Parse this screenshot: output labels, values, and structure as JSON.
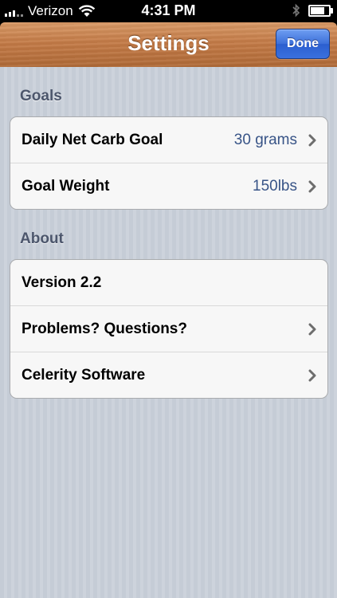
{
  "status_bar": {
    "carrier": "Verizon",
    "time": "4:31 PM"
  },
  "nav": {
    "title": "Settings",
    "done_label": "Done"
  },
  "sections": {
    "goals": {
      "header": "Goals",
      "rows": [
        {
          "label": "Daily Net Carb Goal",
          "value": "30 grams"
        },
        {
          "label": "Goal Weight",
          "value": "150lbs"
        }
      ]
    },
    "about": {
      "header": "About",
      "rows": [
        {
          "label": "Version 2.2"
        },
        {
          "label": "Problems? Questions?"
        },
        {
          "label": "Celerity Software"
        }
      ]
    }
  },
  "colors": {
    "nav_wood": "#c47b47",
    "done_blue": "#3c6fd9",
    "value_text": "#385487",
    "section_header": "#4c566c"
  },
  "icons": [
    "signal-icon",
    "wifi-icon",
    "bluetooth-icon",
    "battery-icon",
    "chevron-right-icon"
  ]
}
